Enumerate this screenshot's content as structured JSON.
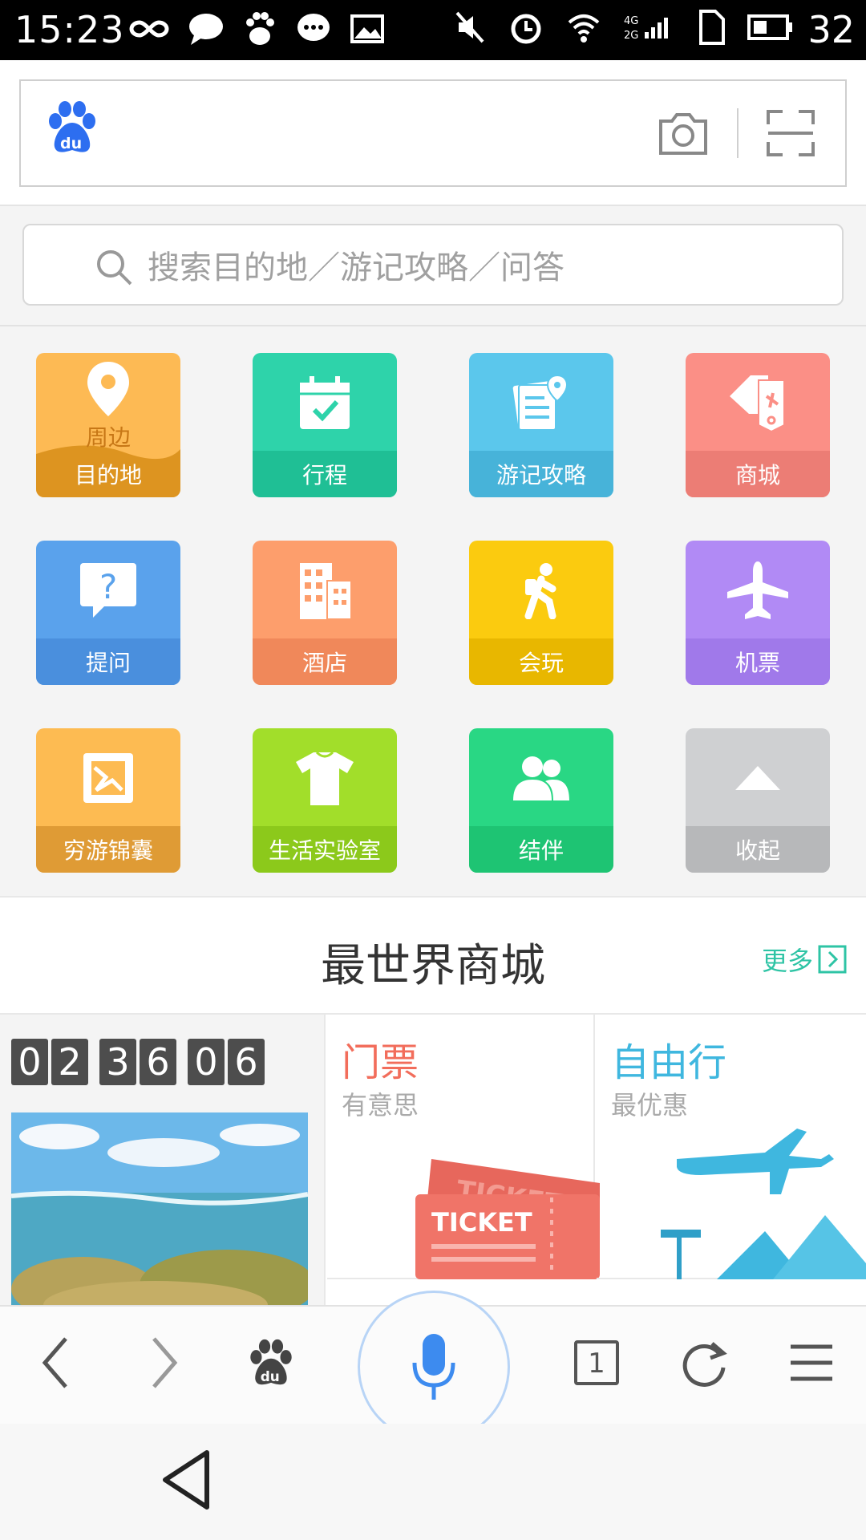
{
  "status_bar": {
    "time": "15:23",
    "battery": "32"
  },
  "search": {
    "placeholder": "搜索目的地／游记攻略／问答"
  },
  "grid": [
    {
      "label": "目的地",
      "sub": "周边",
      "icon": "location-pin-icon",
      "color": "#fdba54",
      "bar": "#dd9420"
    },
    {
      "label": "行程",
      "icon": "calendar-check-icon",
      "color": "#2ed3aa",
      "bar": "#1fbf95"
    },
    {
      "label": "游记攻略",
      "icon": "travel-notes-icon",
      "color": "#5bc7ec",
      "bar": "#47b3d9"
    },
    {
      "label": "商城",
      "icon": "ticket-tag-icon",
      "color": "#fb8f86",
      "bar": "#ec7d75"
    },
    {
      "label": "提问",
      "icon": "question-bubble-icon",
      "color": "#5aa2ec",
      "bar": "#4a8fdd"
    },
    {
      "label": "酒店",
      "icon": "hotel-building-icon",
      "color": "#fd9e6c",
      "bar": "#f0885a"
    },
    {
      "label": "会玩",
      "icon": "hiker-icon",
      "color": "#fbcb0f",
      "bar": "#e8b700"
    },
    {
      "label": "机票",
      "icon": "airplane-icon",
      "color": "#b18af5",
      "bar": "#a079ea"
    },
    {
      "label": "穷游锦囊",
      "icon": "photo-frame-icon",
      "color": "#fdbb52",
      "bar": "#df9b35"
    },
    {
      "label": "生活实验室",
      "icon": "tshirt-icon",
      "color": "#a2de2a",
      "bar": "#8cc91b"
    },
    {
      "label": "结伴",
      "icon": "people-icon",
      "color": "#29d784",
      "bar": "#1ec473"
    },
    {
      "label": "收起",
      "icon": "collapse-arrow-icon",
      "color": "#cfd0d2",
      "bar": "#b7b8ba"
    }
  ],
  "section": {
    "title": "最世界商城",
    "more": "更多"
  },
  "countdown": [
    "0",
    "2",
    "3",
    "6",
    "0",
    "6"
  ],
  "cards": {
    "tickets": {
      "title": "门票",
      "subtitle": "有意思",
      "title_color": "#f26d5b"
    },
    "freetravel": {
      "title": "自由行",
      "subtitle": "最优惠",
      "title_color": "#3fb7df"
    }
  },
  "ticket_text": "TICKET",
  "toolbar": {
    "tab_count": "1"
  }
}
